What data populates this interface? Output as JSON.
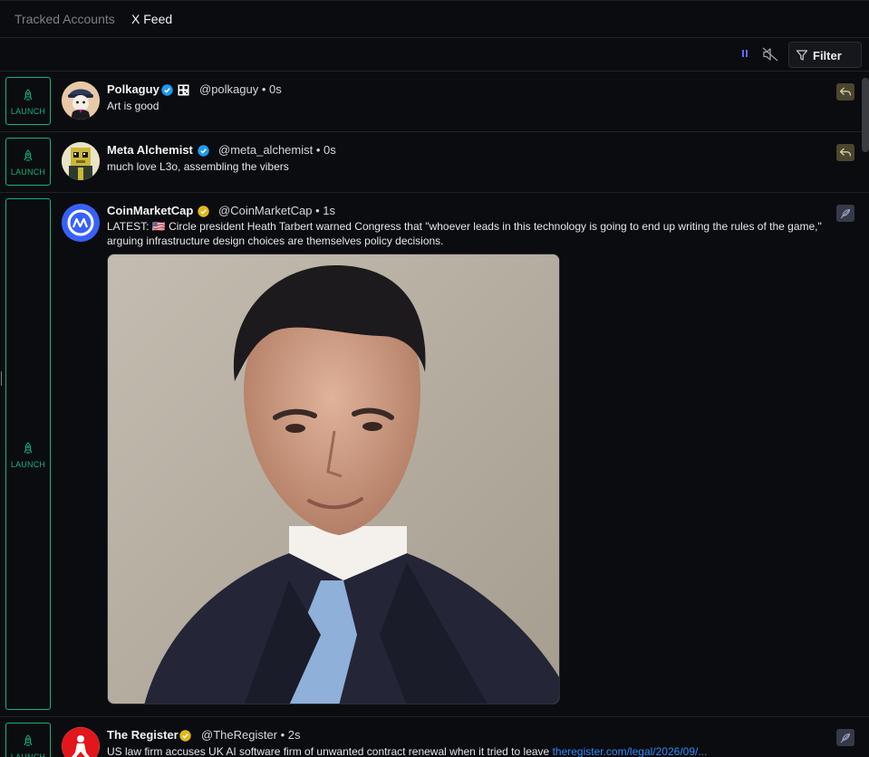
{
  "tabs": [
    {
      "label": "Tracked Accounts",
      "active": false
    },
    {
      "label": "X Feed",
      "active": true
    }
  ],
  "toolbar": {
    "pause_icon": "pause-icon",
    "mute_icon": "speaker-muted-icon",
    "filter_label": "Filter",
    "filter_icon": "funnel-icon"
  },
  "launch_label": "LAUNCH",
  "colors": {
    "accent_green": "#14b37e",
    "verified_blue": "#1d9bf0",
    "verified_gold": "#e2b719",
    "link_blue": "#2f8cff",
    "pause_blue": "#5b6cff"
  },
  "posts": [
    {
      "name": "Polkaguy",
      "badge": "verified-blue",
      "extra_icon": "qr-icon",
      "handle": "@polkaguy",
      "time": "0s",
      "text": "Art is good",
      "action_icon": "reply-icon"
    },
    {
      "name": "Meta Alchemist",
      "badge": "verified-blue",
      "handle": "@meta_alchemist",
      "time": "0s",
      "text": "much love L3o, assembling the vibers",
      "action_icon": "reply-icon"
    },
    {
      "name": "CoinMarketCap",
      "badge": "verified-gold",
      "handle": "@CoinMarketCap",
      "time": "1s",
      "text": "LATEST: 🇺🇸 Circle president Heath Tarbert warned Congress that \"whoever leads in this technology is going to end up writing the rules of the game,\" arguing infrastructure design choices are themselves policy decisions.",
      "media": "portrait photo of man in suit",
      "action_icon": "feather-icon"
    },
    {
      "name": "The Register",
      "badge": "verified-gold",
      "handle": "@TheRegister",
      "time": "2s",
      "text": "US law firm accuses UK AI software firm of unwanted contract renewal when it tried to leave",
      "link": "theregister.com/legal/2026/09/...",
      "action_icon": "feather-icon"
    }
  ]
}
